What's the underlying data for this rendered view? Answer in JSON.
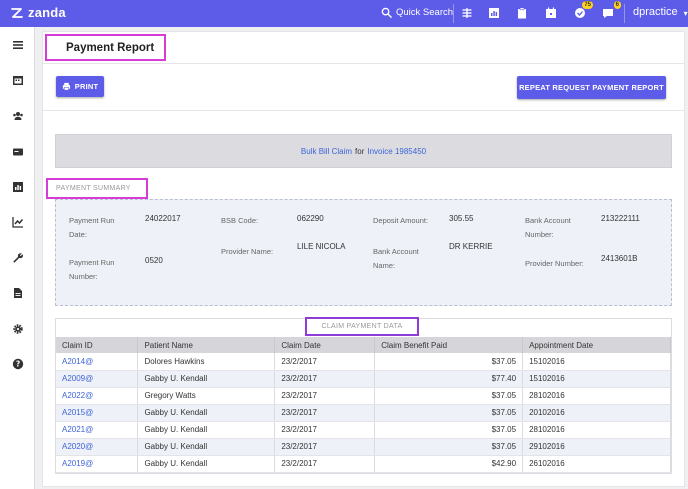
{
  "app": {
    "logo_text": "zanda",
    "brand_color": "#5c5ce8"
  },
  "topbar": {
    "quick_search": "Quick Search",
    "badges": {
      "tasks": "75",
      "messages": "6"
    },
    "user": "dpractice"
  },
  "page": {
    "title": "Payment Report"
  },
  "buttons": {
    "print": "PRINT",
    "repeat": "REPEAT REQUEST PAYMENT REPORT"
  },
  "banner": {
    "claim_link": "Bulk Bill Claim",
    "for_text": "for",
    "invoice_link": "Invoice 1985450"
  },
  "summary": {
    "label": "PAYMENT SUMMARY",
    "payment_run_date_label": "Payment Run Date:",
    "payment_run_date": "24022017",
    "bsb_label": "BSB Code:",
    "bsb": "062290",
    "deposit_label": "Deposit Amount:",
    "deposit": "305.55",
    "bank_account_number_label": "Bank Account Number:",
    "bank_account_number": "213222111",
    "payment_run_number_label": "Payment Run Number:",
    "payment_run_number": "0520",
    "provider_name_label": "Provider Name:",
    "provider_name": "LILE NICOLA",
    "bank_account_name_label": "Bank Account Name:",
    "bank_account_name": "DR KERRIE",
    "provider_number_label": "Provider Number:",
    "provider_number": "2413601B"
  },
  "claims": {
    "label": "CLAIM PAYMENT DATA",
    "columns": [
      "Claim ID",
      "Patient Name",
      "Claim Date",
      "Claim Benefit Paid",
      "Appointment Date"
    ],
    "rows": [
      [
        "A2014@",
        "Dolores Hawkins",
        "23/2/2017",
        "$37.05",
        "15102016"
      ],
      [
        "A2009@",
        "Gabby U. Kendall",
        "23/2/2017",
        "$77.40",
        "15102016"
      ],
      [
        "A2022@",
        "Gregory Watts",
        "23/2/2017",
        "$37.05",
        "28102016"
      ],
      [
        "A2015@",
        "Gabby U. Kendall",
        "23/2/2017",
        "$37.05",
        "20102016"
      ],
      [
        "A2021@",
        "Gabby U. Kendall",
        "23/2/2017",
        "$37.05",
        "28102016"
      ],
      [
        "A2020@",
        "Gabby U. Kendall",
        "23/2/2017",
        "$37.05",
        "29102016"
      ],
      [
        "A2019@",
        "Gabby U. Kendall",
        "23/2/2017",
        "$42.90",
        "26102016"
      ]
    ]
  }
}
